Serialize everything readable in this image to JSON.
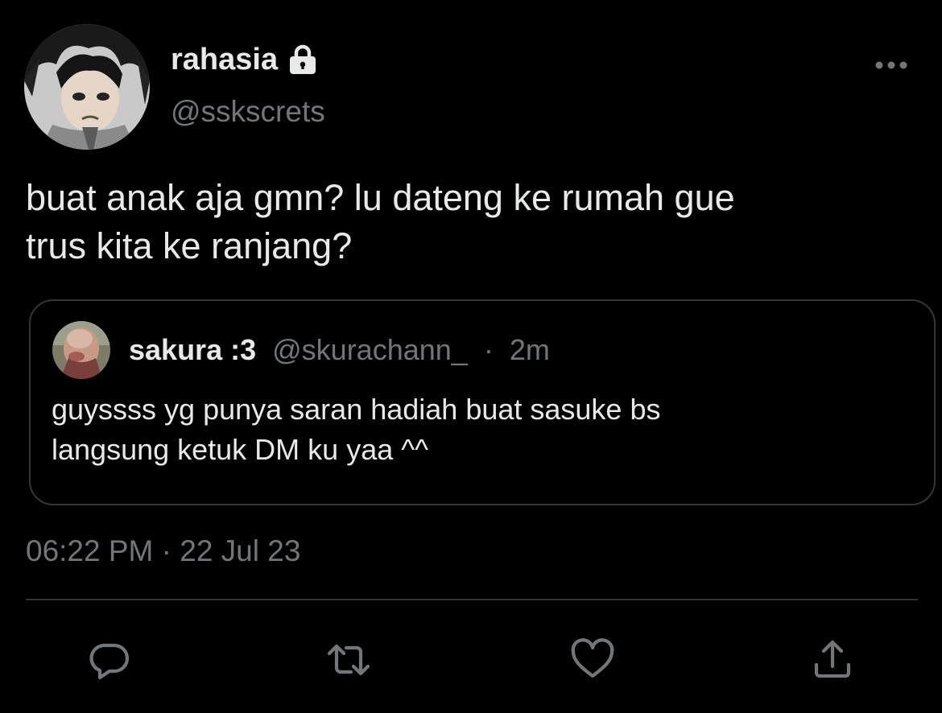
{
  "tweet": {
    "display_name": "rahasia",
    "handle": "@sskscrets",
    "text": "buat anak aja gmn? lu dateng ke rumah gue\ntrus kita ke ranjang?",
    "timestamp": "06:22 PM · 22 Jul 23"
  },
  "quote": {
    "display_name": "sakura :3",
    "handle": "@skurachann_",
    "separator": "·",
    "time": "2m",
    "text": "guyssss yg punya saran hadiah buat sasuke bs\nlangsung ketuk DM ku yaa ^^"
  },
  "icons": {
    "lock": "lock-icon",
    "more": "more-horizontal-icon",
    "reply": "reply-icon",
    "retweet": "retweet-icon",
    "like": "heart-icon",
    "share": "share-icon"
  },
  "colors": {
    "background": "#000000",
    "primary_text": "#e7e9ea",
    "secondary_text": "#71767b",
    "border": "#333639",
    "icon": "#71767b"
  }
}
